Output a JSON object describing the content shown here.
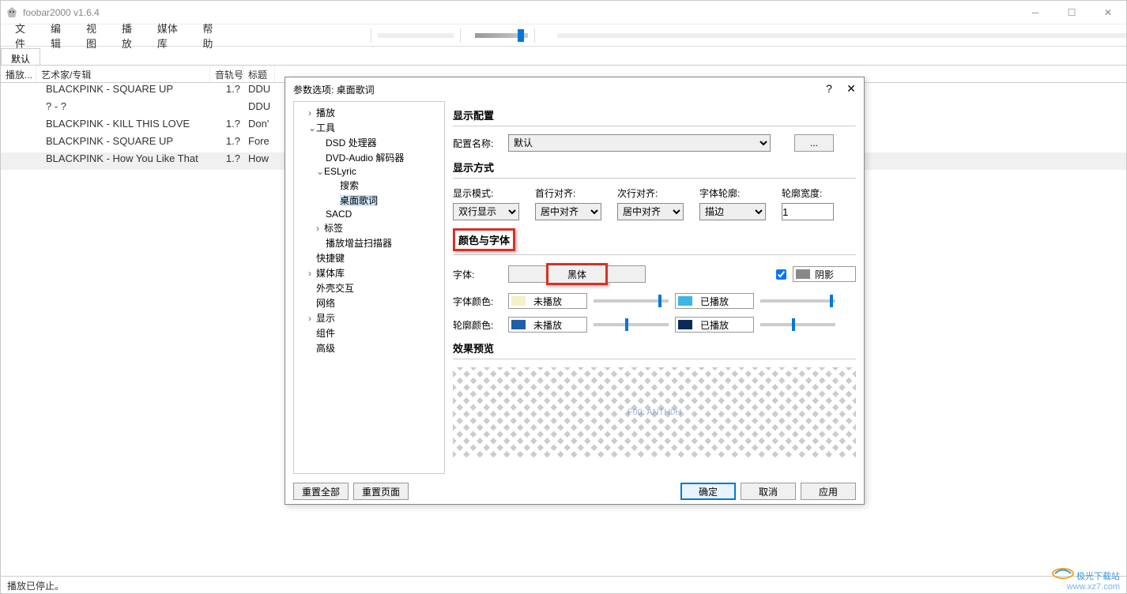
{
  "window": {
    "title": "foobar2000 v1.6.4"
  },
  "menu": [
    "文件",
    "编辑",
    "视图",
    "播放",
    "媒体库",
    "帮助"
  ],
  "tab": "默认",
  "columns": {
    "play": "播放...",
    "artist": "艺术家/专辑",
    "track": "音轨号",
    "title": "标题"
  },
  "rows": [
    {
      "artist": "BLACKPINK - SQUARE UP",
      "track": "1.?",
      "title": "DDU"
    },
    {
      "artist": "? - ?",
      "track": "",
      "title": "DDU"
    },
    {
      "artist": "BLACKPINK - KILL THIS LOVE",
      "track": "1.?",
      "title": "Don'"
    },
    {
      "artist": "BLACKPINK - SQUARE UP",
      "track": "1.?",
      "title": "Fore"
    },
    {
      "artist": "BLACKPINK - How You Like That",
      "track": "1.?",
      "title": "How"
    }
  ],
  "status": "播放已停止。",
  "dialog": {
    "title": "参数选项: 桌面歌词",
    "tree": {
      "play": "播放",
      "tools": "工具",
      "dsd": "DSD 处理器",
      "dvd": "DVD-Audio 解码器",
      "eslyric": "ESLyric",
      "search": "搜索",
      "desklyric": "桌面歌词",
      "sacd": "SACD",
      "tag": "标签",
      "gain": "播放增益扫描器",
      "shortcut": "快捷键",
      "medialib": "媒体库",
      "shell": "外壳交互",
      "network": "网络",
      "display": "显示",
      "component": "组件",
      "advanced": "高级"
    },
    "sections": {
      "display_config": "显示配置",
      "display_mode": "显示方式",
      "color_font": "颜色与字体",
      "preview": "效果预览"
    },
    "labels": {
      "config_name": "配置名称:",
      "mode": "显示模式:",
      "first_align": "首行对齐:",
      "next_align": "次行对齐:",
      "font_outline": "字体轮廓:",
      "outline_width": "轮廓宽度:",
      "font": "字体:",
      "shadow": "阴影",
      "font_color": "字体颜色:",
      "outline_color": "轮廓颜色:",
      "unplayed": "未播放",
      "played": "已播放"
    },
    "values": {
      "config_name": "默认",
      "mode": "双行显示",
      "first_align": "居中对齐",
      "next_align": "居中对齐",
      "font_outline": "描边",
      "outline_width": "1",
      "font_name": "黑体",
      "preview_text": "F00: ANTH0H"
    },
    "buttons": {
      "more": "...",
      "reset_all": "重置全部",
      "reset_page": "重置页面",
      "ok": "确定",
      "cancel": "取消",
      "apply": "应用"
    }
  },
  "watermark": {
    "line1": "极光下载站",
    "line2": "www.xz7.com"
  }
}
